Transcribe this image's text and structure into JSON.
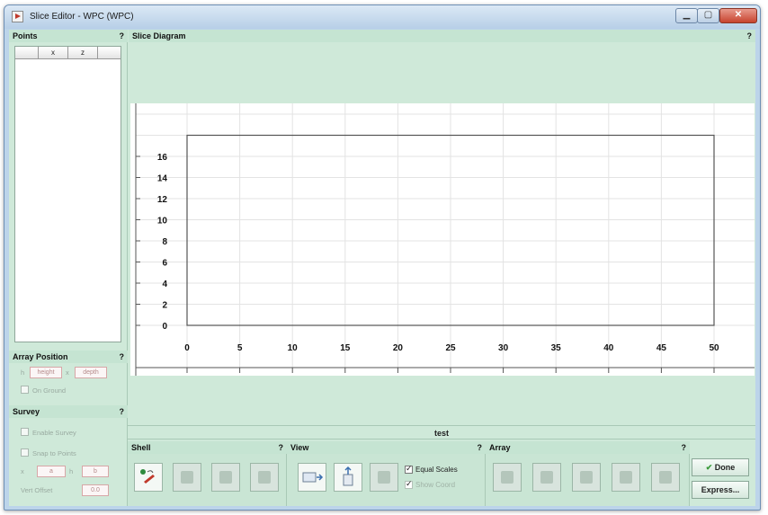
{
  "window": {
    "title": "Slice Editor - WPC (WPC)"
  },
  "points": {
    "header": "Points",
    "help": "?",
    "columns": [
      "",
      "x",
      "z"
    ]
  },
  "array_position": {
    "header": "Array Position",
    "help": "?",
    "h_label": "h",
    "height_value": "height",
    "x_label": "x",
    "depth_value": "depth",
    "on_ground": "On Ground"
  },
  "survey": {
    "header": "Survey",
    "help": "?",
    "enable_survey": "Enable Survey",
    "snap_to_points": "Snap to Points",
    "x_label": "x",
    "x_value": "a",
    "h_label": "h",
    "h_value": "b",
    "vert_offset_label": "Vert Offset",
    "vert_offset_value": "0.0"
  },
  "diagram": {
    "header": "Slice Diagram",
    "help": "?",
    "x_ticks": [
      0,
      5,
      10,
      15,
      20,
      25,
      30,
      35,
      40,
      45,
      50
    ],
    "y_ticks": [
      0,
      2,
      4,
      6,
      8,
      10,
      12,
      14,
      16
    ],
    "rect": {
      "x0": 0,
      "x1": 50,
      "y0": 0,
      "y1": 18
    }
  },
  "status_label": "test",
  "shell": {
    "header": "Shell",
    "help": "?"
  },
  "view": {
    "header": "View",
    "help": "?",
    "equal_scales": "Equal Scales",
    "show_coord": "Show Coord"
  },
  "array_tools": {
    "header": "Array",
    "help": "?"
  },
  "actions": {
    "done": "Done",
    "express": "Express..."
  }
}
